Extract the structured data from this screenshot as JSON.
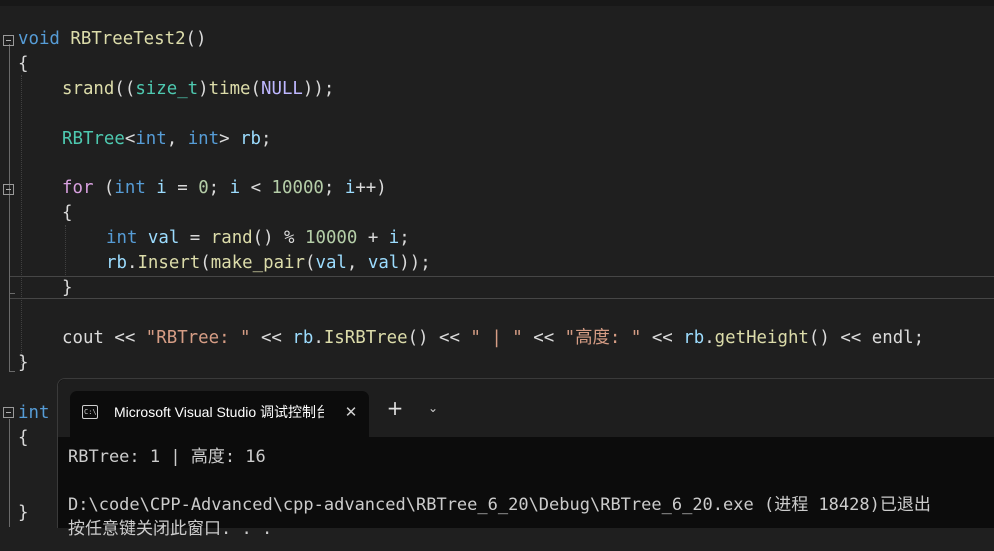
{
  "editor": {
    "fn1": {
      "ret": "void",
      "name": "RBTreeTest2",
      "params": "()",
      "open_brace": "{",
      "close_brace": "}"
    },
    "l_srand": {
      "f_srand": "srand",
      "p1": "((",
      "type": "size_t",
      "p2": ")",
      "f_time": "time",
      "p3": "(",
      "null_macro": "NULL",
      "p4": "));"
    },
    "l_decl": {
      "cls": "RBTree",
      "lt": "<",
      "t1": "int",
      "comma": ", ",
      "t2": "int",
      "gt": ">",
      "sp": " ",
      "var": "rb",
      "semi": ";"
    },
    "l_for": {
      "kw": "for",
      "p1": " (",
      "t": "int",
      "sp": " ",
      "v1": "i",
      "eq": " = ",
      "n0": "0",
      "s1": "; ",
      "v2": "i",
      "lt": " < ",
      "n1": "10000",
      "s2": "; ",
      "v3": "i",
      "inc": "++)",
      "open_brace": "{",
      "close_brace": "}"
    },
    "l_val": {
      "t": "int",
      "sp": " ",
      "v": "val",
      "eq": " = ",
      "f": "rand",
      "call": "() % ",
      "n": "10000",
      "plus": " + ",
      "i": "i",
      "semi": ";"
    },
    "l_insert": {
      "obj": "rb",
      "dot": ".",
      "m": "Insert",
      "p1": "(",
      "f": "make_pair",
      "p2": "(",
      "a1": "val",
      "c": ", ",
      "a2": "val",
      "end": "));"
    },
    "l_cout": {
      "c": "cout",
      "o1": " << ",
      "s1": "\"RBTree: \"",
      "o2": " << ",
      "obj1": "rb",
      "d1": ".",
      "m1": "IsRBTree",
      "p1": "()",
      "o3": " << ",
      "s2": "\" | \"",
      "o4": " << ",
      "s3": "\"高度: \"",
      "o5": " << ",
      "obj2": "rb",
      "d2": ".",
      "m2": "getHeight",
      "p2": "()",
      "o6": " << ",
      "e": "endl",
      "semi": ";"
    },
    "fn2": {
      "ret": "int",
      "open_brace": "{",
      "close_brace": "}"
    }
  },
  "terminal": {
    "tab_title": "Microsoft Visual Studio 调试控制台",
    "tab_icon_text": "C:\\",
    "close_glyph": "✕",
    "new_tab_glyph": "+",
    "dropdown_glyph": "⌄",
    "output_line1": "RBTree: 1 | 高度: 16",
    "output_line2": "D:\\code\\CPP-Advanced\\cpp-advanced\\RBTree_6_20\\Debug\\RBTree_6_20.exe (进程 18428)已退出",
    "output_line3": "按任意键关闭此窗口. . ."
  },
  "colors": {
    "background": "#1f1f1f",
    "keyword": "#569cd6",
    "type": "#4ec9b0",
    "function": "#dcdcaa",
    "variable": "#9cdcfe",
    "number": "#b5cea8",
    "string": "#d69d85",
    "macro": "#beb7ff",
    "terminal_bg": "#0c0c0c"
  }
}
